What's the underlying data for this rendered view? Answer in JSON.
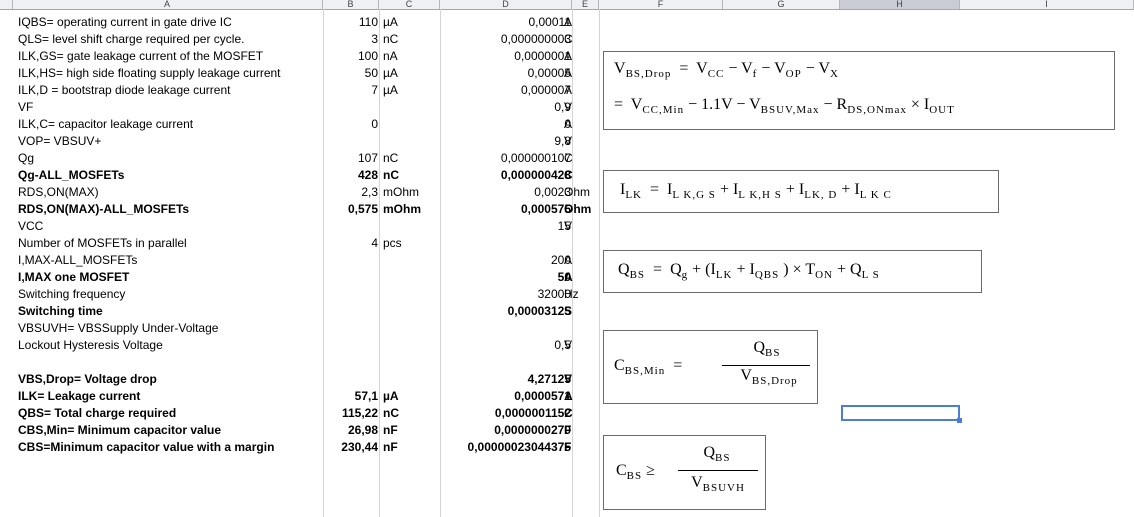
{
  "columns": [
    "A",
    "B",
    "C",
    "D",
    "E",
    "F",
    "G",
    "H",
    "I"
  ],
  "rows": [
    {
      "a": "IQBS= operating current in gate drive IC",
      "b": "110",
      "c": "µA",
      "d": "0,00011",
      "e": "A",
      "bold": false
    },
    {
      "a": "QLS= level shift charge required per cycle.",
      "b": "3",
      "c": "nC",
      "d": "0,000000003",
      "e": "C",
      "bold": false
    },
    {
      "a": "ILK,GS= gate leakage current of the MOSFET",
      "b": "100",
      "c": "nA",
      "d": "0,0000001",
      "e": "A",
      "bold": false
    },
    {
      "a": "ILK,HS= high side floating supply leakage current",
      "b": "50",
      "c": "µA",
      "d": "0,00005",
      "e": "A",
      "bold": false
    },
    {
      "a": "ILK,D = bootstrap diode leakage current",
      "b": "7",
      "c": "µA",
      "d": "0,000007",
      "e": "A",
      "bold": false
    },
    {
      "a": "VF",
      "b": "",
      "c": "",
      "d": "0,9",
      "e": "V",
      "bold": false
    },
    {
      "a": "ILK,C= capacitor leakage current",
      "b": "0",
      "c": "",
      "d": "0",
      "e": "A",
      "bold": false
    },
    {
      "a": "VOP= VBSUV+",
      "b": "",
      "c": "",
      "d": "9,8",
      "e": "V",
      "bold": false
    },
    {
      "a": "Qg",
      "b": "107",
      "c": "nC",
      "d": "0,000000107",
      "e": "C",
      "bold": false
    },
    {
      "a": "Qg-ALL_MOSFETs",
      "b": "428",
      "c": "nC",
      "d": "0,000000428",
      "e": "C",
      "bold": true
    },
    {
      "a": "RDS,ON(MAX)",
      "b": "2,3",
      "c": "mOhm",
      "d": "0,0023",
      "e": "Ohm",
      "bold": false
    },
    {
      "a": "RDS,ON(MAX)-ALL_MOSFETs",
      "b": "0,575",
      "c": "mOhm",
      "d": "0,000575",
      "e": "Ohm",
      "bold": true
    },
    {
      "a": "VCC",
      "b": "",
      "c": "",
      "d": "15",
      "e": "V",
      "bold": false
    },
    {
      "a": "Number of MOSFETs in parallel",
      "b": "4",
      "c": "pcs",
      "d": "",
      "e": "",
      "bold": false
    },
    {
      "a": "I,MAX-ALL_MOSFETs",
      "b": "",
      "c": "",
      "d": "200",
      "e": "A",
      "bold": false
    },
    {
      "a": "I,MAX one MOSFET",
      "b": "",
      "c": "",
      "d": "50",
      "e": "A",
      "bold": true
    },
    {
      "a": "Switching frequency",
      "b": "",
      "c": "",
      "d": "32000",
      "e": "Hz",
      "bold": false
    },
    {
      "a": "Switching time",
      "b": "",
      "c": "",
      "d": "0,00003125",
      "e": "S",
      "bold": true
    },
    {
      "a": "VBSUVH= VBSSupply Under-Voltage",
      "b": "",
      "c": "",
      "d": "",
      "e": "",
      "bold": false
    },
    {
      "a": "Lockout Hysteresis Voltage",
      "b": "",
      "c": "",
      "d": "0,5",
      "e": "V",
      "bold": false
    },
    {
      "a": "",
      "b": "",
      "c": "",
      "d": "",
      "e": "",
      "bold": false
    },
    {
      "a": "VBS,Drop= Voltage drop",
      "b": "",
      "c": "",
      "d": "4,27125",
      "e": "V",
      "bold": true
    },
    {
      "a": "ILK= Leakage current",
      "b": "57,1",
      "c": "µA",
      "d": "0,0000571",
      "e": "A",
      "bold": true
    },
    {
      "a": "QBS= Total charge required",
      "b": "115,22",
      "c": "nC",
      "d": "0,0000001152",
      "e": "C",
      "bold": true
    },
    {
      "a": "CBS,Min= Minimum capacitor value",
      "b": "26,98",
      "c": "nF",
      "d": "0,0000000270",
      "e": "F",
      "bold": true
    },
    {
      "a": "CBS=Minimum capacitor value with a margin",
      "b": "230,44",
      "c": "nF",
      "d": "0,00000023044375",
      "e": "F",
      "bold": true
    }
  ],
  "formulas": {
    "vbs_drop": {
      "line1": {
        "lhs": "V",
        "lhs_sub": "BS,Drop",
        "eq": "=",
        "t1": "V",
        "t1_sub": "CC",
        "m1": "− V",
        "t2_sub": "f",
        "m2": "− V",
        "t3_sub": "OP",
        "m3": "− V",
        "t4_sub": "X"
      },
      "line2": {
        "eq": "=",
        "t1": "V",
        "t1_sub": "CC,Min",
        "m1": "− 1.1V − V",
        "t2_sub": "BSUV,Max",
        "m2": "− R",
        "t3_sub": "DS,ONmax",
        "m3": "× I",
        "t4_sub": "OUT"
      }
    },
    "ilk": {
      "lhs": "I",
      "lhs_sub": "LK",
      "eq": "=",
      "t1": "I",
      "t1_sub": "L K,G S",
      "p1": "+ I",
      "t2_sub": "L K,H S",
      "p2": "+ I",
      "t3_sub": "LK, D",
      "p3": "+ I",
      "t4_sub": "L K C"
    },
    "qbs": {
      "lhs": "Q",
      "lhs_sub": "BS",
      "eq": "=",
      "t1": "Q",
      "t1_sub": "g",
      "m1": "+ (I",
      "t2_sub": "LK",
      "m2": "+ I",
      "t3_sub": "QBS",
      "m3": ") × T",
      "t4_sub": "ON",
      "m4": "+ Q",
      "t5_sub": "L S"
    },
    "cbs_min": {
      "lhs": "C",
      "lhs_sub": "BS,Min",
      "eq": "=",
      "num": "Q",
      "num_sub": "BS",
      "den": "V",
      "den_sub": "BS,Drop"
    },
    "cbs": {
      "lhs": "C",
      "lhs_sub": "BS",
      "eq": "≥",
      "num": "Q",
      "num_sub": "BS",
      "den": "V",
      "den_sub": "BSUVH"
    }
  }
}
